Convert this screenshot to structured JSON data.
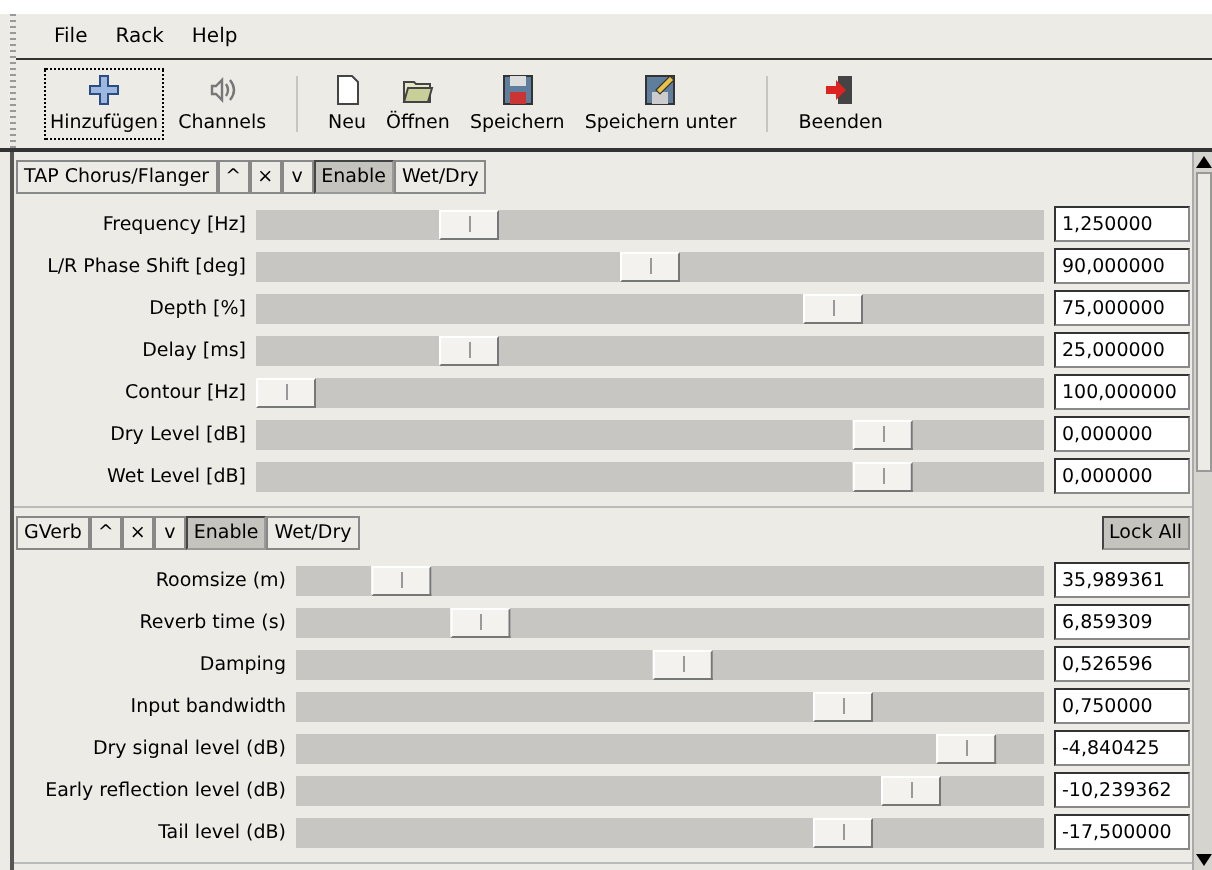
{
  "menu": [
    "File",
    "Rack",
    "Help"
  ],
  "toolbar": [
    {
      "label": "Hinzufügen",
      "focused": true
    },
    {
      "label": "Channels",
      "focused": false
    },
    {
      "kind": "separator"
    },
    {
      "label": "Neu",
      "focused": false
    },
    {
      "label": "Öffnen",
      "focused": false
    },
    {
      "label": "Speichern",
      "focused": false
    },
    {
      "label": "Speichern unter",
      "focused": false
    },
    {
      "kind": "separator"
    },
    {
      "label": "Beenden",
      "focused": false
    }
  ],
  "plugins": [
    {
      "name": "TAP Chorus/Flanger",
      "controls": [
        "^",
        "×",
        "v"
      ],
      "enable": {
        "label": "Enable",
        "on": true
      },
      "wet_dry": {
        "label": "Wet/Dry",
        "on": false
      },
      "params": [
        {
          "label": "Frequency [Hz]",
          "level": 0.25,
          "value": "1,250000"
        },
        {
          "label": "L/R Phase Shift [deg]",
          "level": 0.5,
          "value": "90,000000"
        },
        {
          "label": "Depth [%]",
          "level": 0.75,
          "value": "75,000000"
        },
        {
          "label": "Delay [ms]",
          "level": 0.25,
          "value": "25,000000"
        },
        {
          "label": "Contour [Hz]",
          "level": 0.0,
          "value": "100,000000"
        },
        {
          "label": "Dry Level [dB]",
          "level": 0.82,
          "value": "0,000000"
        },
        {
          "label": "Wet Level [dB]",
          "level": 0.82,
          "value": "0,000000"
        }
      ]
    },
    {
      "name": "GVerb",
      "controls": [
        "^",
        "×",
        "v"
      ],
      "enable": {
        "label": "Enable",
        "on": true
      },
      "wet_dry": {
        "label": "Wet/Dry",
        "on": false
      },
      "lock_all": {
        "label": "Lock All",
        "on": true
      },
      "params": [
        {
          "label": "Roomsize (m)",
          "level": 0.11,
          "value": "35,989361"
        },
        {
          "label": "Reverb time (s)",
          "level": 0.225,
          "value": "6,859309"
        },
        {
          "label": "Damping",
          "level": 0.52,
          "value": "0,526596"
        },
        {
          "label": "Input bandwidth",
          "level": 0.75,
          "value": "0,750000"
        },
        {
          "label": "Dry signal level (dB)",
          "level": 0.93,
          "value": "-4,840425"
        },
        {
          "label": "Early reflection level (dB)",
          "level": 0.85,
          "value": "-10,239362"
        },
        {
          "label": "Tail level (dB)",
          "level": 0.75,
          "value": "-17,500000"
        }
      ]
    }
  ]
}
